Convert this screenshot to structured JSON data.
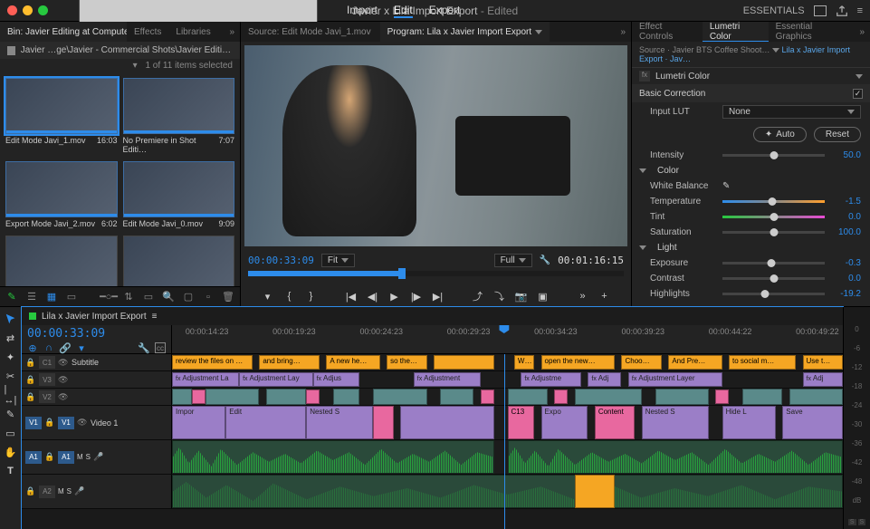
{
  "titlebar": {
    "menu": [
      "Import",
      "Edit",
      "Export"
    ],
    "active_menu": "Edit",
    "title": "Javier x Lila Import Export",
    "title_suffix": " - Edited",
    "workspace": "ESSENTIALS"
  },
  "bin_panel": {
    "tabs": [
      "Bin: Javier Editing at Computer B Roll",
      "Effects",
      "Libraries"
    ],
    "breadcrumb": "Javier …ge\\Javier - Commercial Shots\\Javier Editing at Computer B Roll",
    "selection": "1 of 11 items selected",
    "clips": [
      {
        "name": "Edit Mode Javi_1.mov",
        "dur": "16:03",
        "sel": true
      },
      {
        "name": "No Premiere in Shot Editi…",
        "dur": "7:07"
      },
      {
        "name": "Export Mode Javi_2.mov",
        "dur": "6:02"
      },
      {
        "name": "Edit Mode Javi_0.mov",
        "dur": "9:09"
      }
    ]
  },
  "monitor": {
    "source_tab": "Source: Edit Mode Javi_1.mov",
    "program_tab": "Program: Lila x Javier Import Export",
    "tc_left": "00:00:33:09",
    "tc_right": "00:01:16:15",
    "zoom": "Fit",
    "quality": "Full"
  },
  "lumetri": {
    "tabs": [
      "Effect Controls",
      "Lumetri Color",
      "Essential Graphics"
    ],
    "source": "Source · Javier BTS Coffee Shoot…",
    "clip": "Lila x Javier Import Export · Jav…",
    "fx_name": "Lumetri Color",
    "sections": {
      "basic": "Basic Correction",
      "lut_label": "Input LUT",
      "lut_value": "None",
      "auto": "Auto",
      "reset": "Reset",
      "intensity_label": "Intensity",
      "intensity_val": "50.0",
      "color": "Color",
      "wb": "White Balance",
      "temp_label": "Temperature",
      "temp_val": "-1.5",
      "tint_label": "Tint",
      "tint_val": "0.0",
      "sat_label": "Saturation",
      "sat_val": "100.0",
      "light": "Light",
      "exp_label": "Exposure",
      "exp_val": "-0.3",
      "con_label": "Contrast",
      "con_val": "0.0",
      "hl_label": "Highlights",
      "hl_val": "-19.2"
    }
  },
  "timeline": {
    "seq_name": "Lila x Javier Import Export",
    "tc": "00:00:33:09",
    "ruler": [
      "00:00:14:23",
      "00:00:19:23",
      "00:00:24:23",
      "00:00:29:23",
      "00:00:34:23",
      "00:00:39:23",
      "00:00:44:22",
      "00:00:49:22"
    ],
    "tracks": {
      "c1": "C1",
      "c1_label": "Subtitle",
      "v3": "V3",
      "v2": "V2",
      "v1": "V1",
      "v1_label": "Video 1",
      "a1": "A1",
      "a2": "A2"
    },
    "subtitle_clips": [
      "review the files on …",
      "and bring…",
      "A new he…",
      "so the…",
      "",
      "W…",
      "open the new…",
      "Choo…",
      "And Pre…",
      "to social m…",
      "Use t…"
    ],
    "v3_clips": [
      "Adjustment La",
      "Adjustment Lay",
      "Adjus",
      "",
      "Adjustment",
      "Adjustme",
      "Adj",
      "Adjustment Layer",
      "Adj"
    ],
    "v1_clips": [
      "Impor",
      "Edit",
      "Nested S",
      "C13",
      "Expo",
      "Content",
      "Nested S",
      "Hide L",
      "Save"
    ]
  },
  "meters": [
    "0",
    "-6",
    "-12",
    "-18",
    "-24",
    "-30",
    "-36",
    "-42",
    "-48",
    "dB"
  ]
}
